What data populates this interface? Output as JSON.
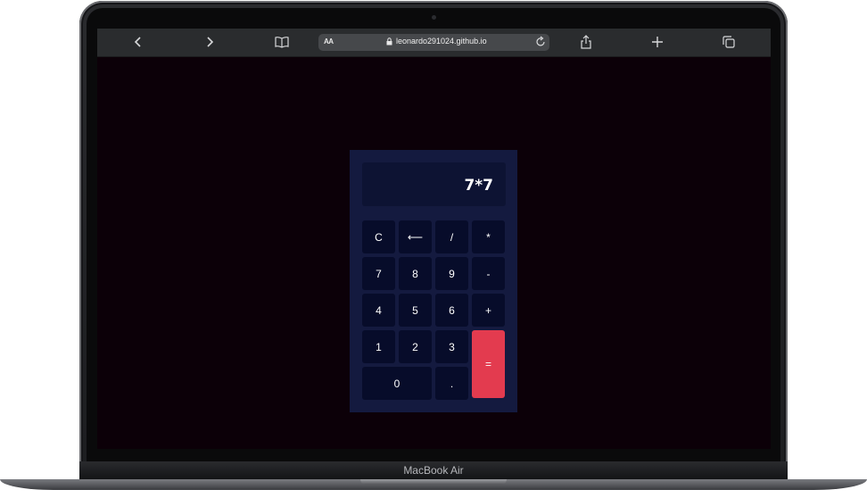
{
  "browser": {
    "url_text": "leonardo291024.github.io",
    "text_size_label": "AA"
  },
  "calculator": {
    "display": "7*7",
    "keys": [
      "C",
      "⟵",
      "/",
      "*",
      "7",
      "8",
      "9",
      "-",
      "4",
      "5",
      "6",
      "+",
      "1",
      "2",
      "3",
      "=",
      "0",
      "."
    ],
    "colors": {
      "equals": "#e33b4f",
      "key": "#070c2a",
      "panel": "#141a3f"
    }
  },
  "device": {
    "label": "MacBook Air"
  }
}
